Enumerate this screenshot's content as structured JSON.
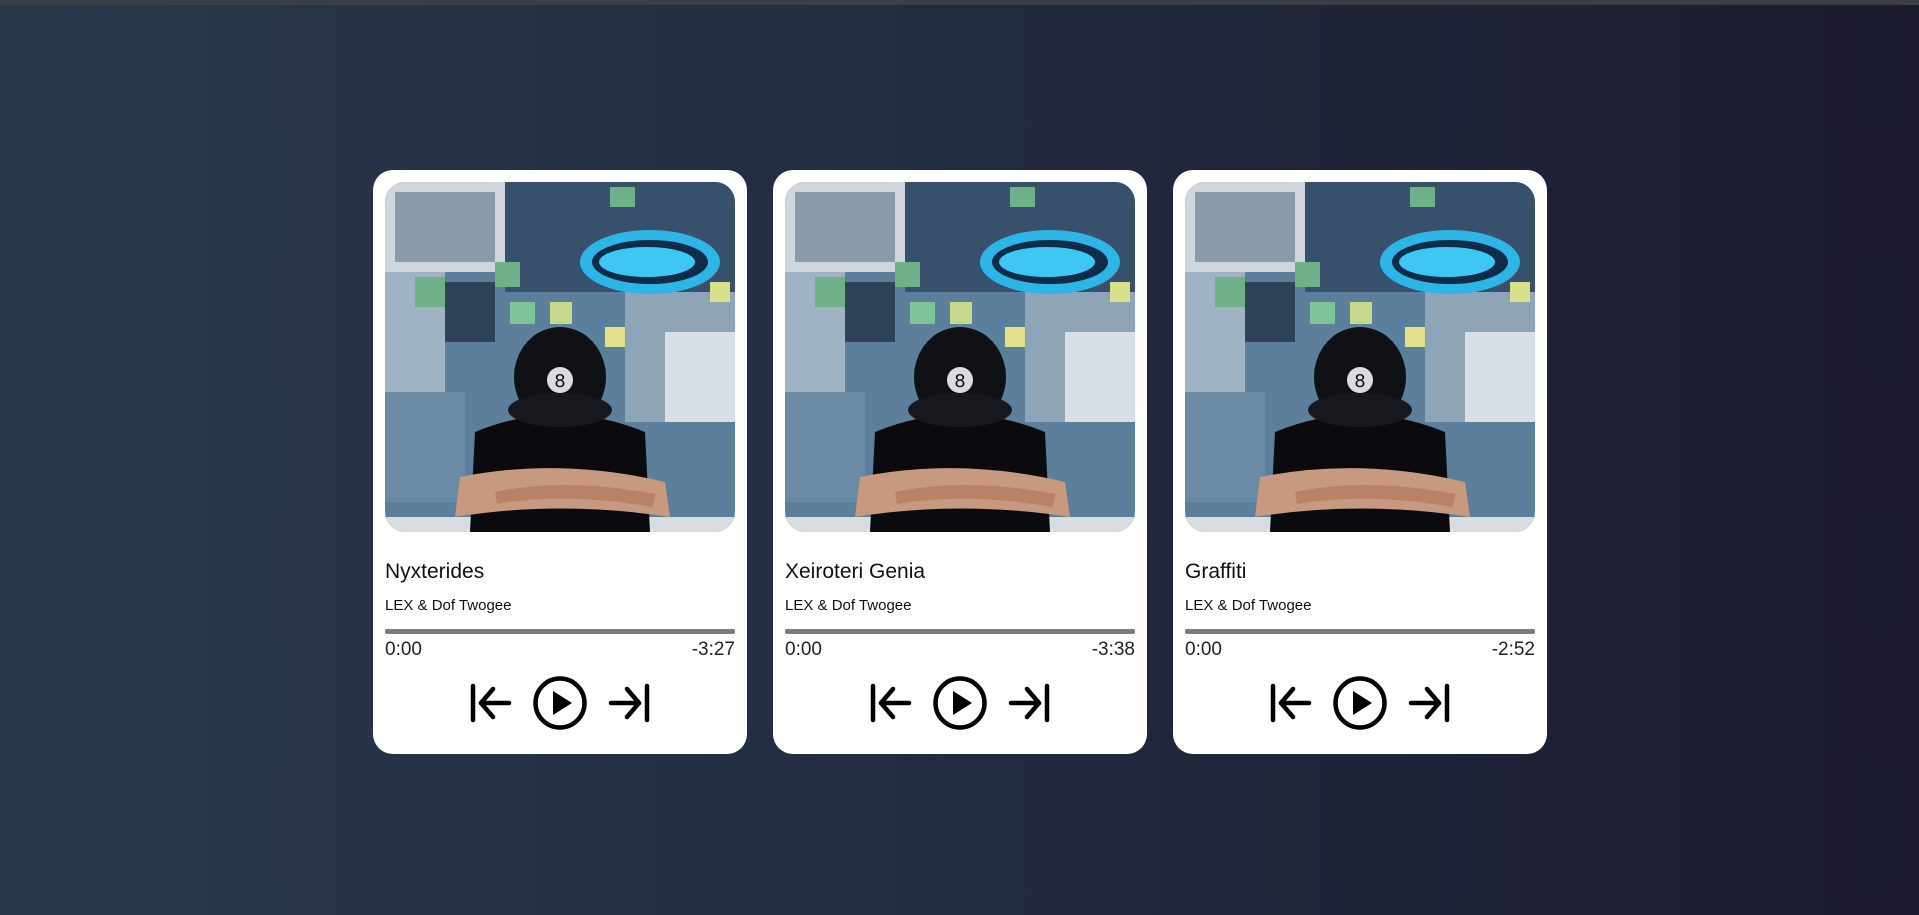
{
  "accent": "#ffffff",
  "tracks": [
    {
      "title": "Nyxterides",
      "artist": "LEX & Dof Twogee",
      "current_time": "0:00",
      "remaining_time": "-3:27",
      "progress": 0
    },
    {
      "title": "Xeiroteri Genia",
      "artist": "LEX & Dof Twogee",
      "current_time": "0:00",
      "remaining_time": "-3:38",
      "progress": 0
    },
    {
      "title": "Graffiti",
      "artist": "LEX & Dof Twogee",
      "current_time": "0:00",
      "remaining_time": "-2:52",
      "progress": 0
    }
  ],
  "icons": {
    "previous": "skip-previous-icon",
    "play": "play-circle-icon",
    "next": "skip-next-icon"
  }
}
